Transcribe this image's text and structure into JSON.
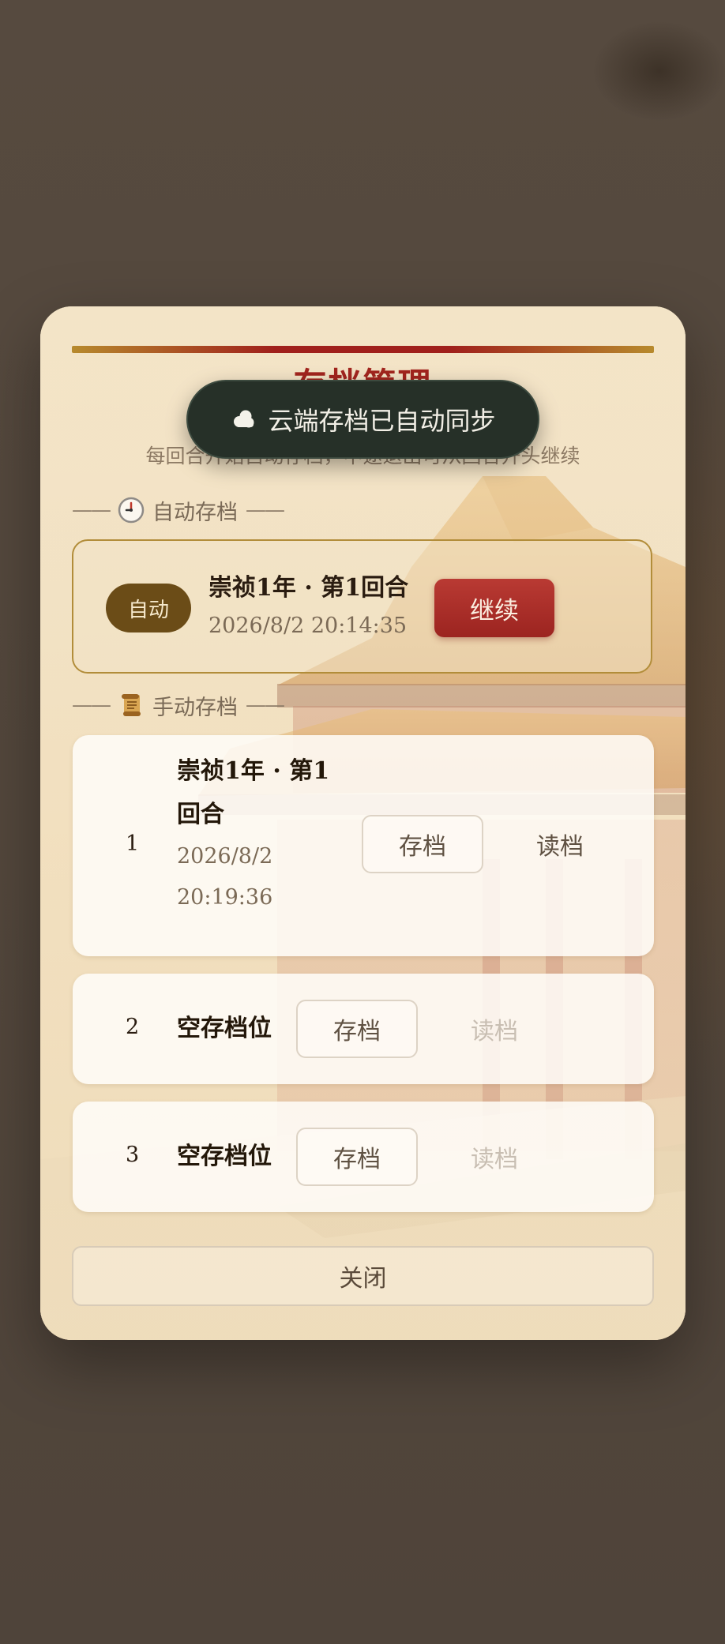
{
  "modal": {
    "title": "存档管理",
    "subtitle": "每回合开始自动存档，中途退出可从回合开头继续"
  },
  "auto_section": {
    "label": "自动存档",
    "dash_left": "——",
    "dash_right": "——",
    "icon": "clock-icon",
    "slot": {
      "badge": "自动",
      "title": "崇祯1年 · 第1回合",
      "time": "2026/8/2 20:14:35",
      "continue_label": "继续"
    }
  },
  "manual_section": {
    "label": "手动存档",
    "dash_left": "——",
    "dash_right": "——",
    "icon": "scroll-icon",
    "slots": [
      {
        "number": "1",
        "title_line1": "崇祯1年 · 第1",
        "title_line2": "回合",
        "time_line1": "2026/8/2",
        "time_line2": "20:19:36",
        "save_label": "存档",
        "load_label": "读档",
        "load_enabled": true
      },
      {
        "number": "2",
        "title": "空存档位",
        "save_label": "存档",
        "load_label": "读档",
        "load_enabled": false
      },
      {
        "number": "3",
        "title": "空存档位",
        "save_label": "存档",
        "load_label": "读档",
        "load_enabled": false
      }
    ]
  },
  "close_label": "关闭",
  "toast": {
    "icon": "cloud-icon",
    "text": "云端存档已自动同步"
  },
  "colors": {
    "accent_red": "#a2251e",
    "badge_brown": "#6b4c17",
    "toast_bg": "#263028"
  }
}
